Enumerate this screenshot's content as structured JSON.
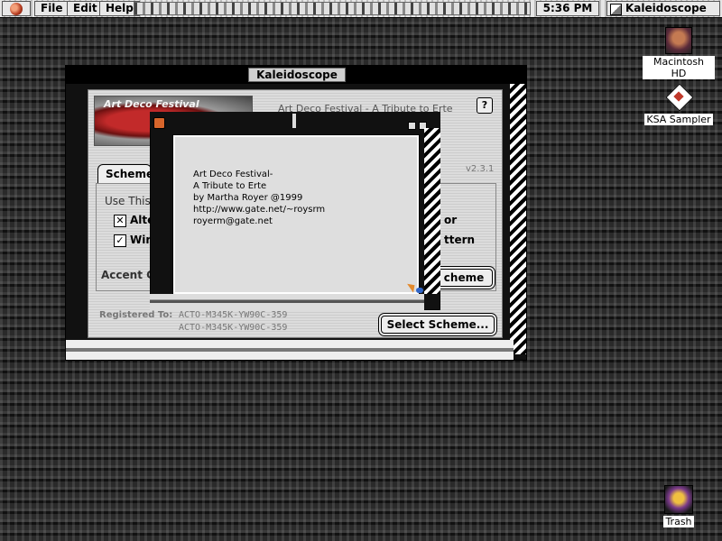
{
  "menubar": {
    "items": [
      "File",
      "Edit",
      "Help"
    ],
    "clock": "5:36 PM",
    "app_name": "Kaleidoscope"
  },
  "desktop": {
    "icons": [
      {
        "label": "Macintosh HD"
      },
      {
        "label": "KSA Sampler"
      },
      {
        "label": "Trash"
      }
    ]
  },
  "main_window": {
    "title": "Kaleidoscope",
    "banner_text": "Art Deco Festival",
    "scheme_name": "Art Deco Festival - A Tribute to Erte",
    "help_label": "?",
    "version": "v2.3.1",
    "tab_label": "Scheme",
    "use_label": "Use This",
    "checkbox_1_label": "Alte",
    "checkbox_2_label": "Win",
    "right_label_1": "or",
    "right_label_2": "ttern",
    "accent_label": "Accent C",
    "scheme_button_label": "cheme",
    "select_scheme_label": "Select Scheme...",
    "registered_label": "Registered To:",
    "reg_code_1": "ACTO-M345K-YW90C-359",
    "reg_code_2": "ACTO-M345K-YW90C-359"
  },
  "about_dialog": {
    "lines": [
      "Art Deco Festival-",
      "A Tribute to Erte",
      "by  Martha Royer @1999",
      "http://www.gate.net/~roysrm",
      "royerm@gate.net"
    ]
  },
  "colors": {
    "menubar_bg": "#d8d8d8",
    "window_frame": "#111111",
    "content_bg": "#dcdcdc",
    "accent_red": "#c22a2a"
  }
}
